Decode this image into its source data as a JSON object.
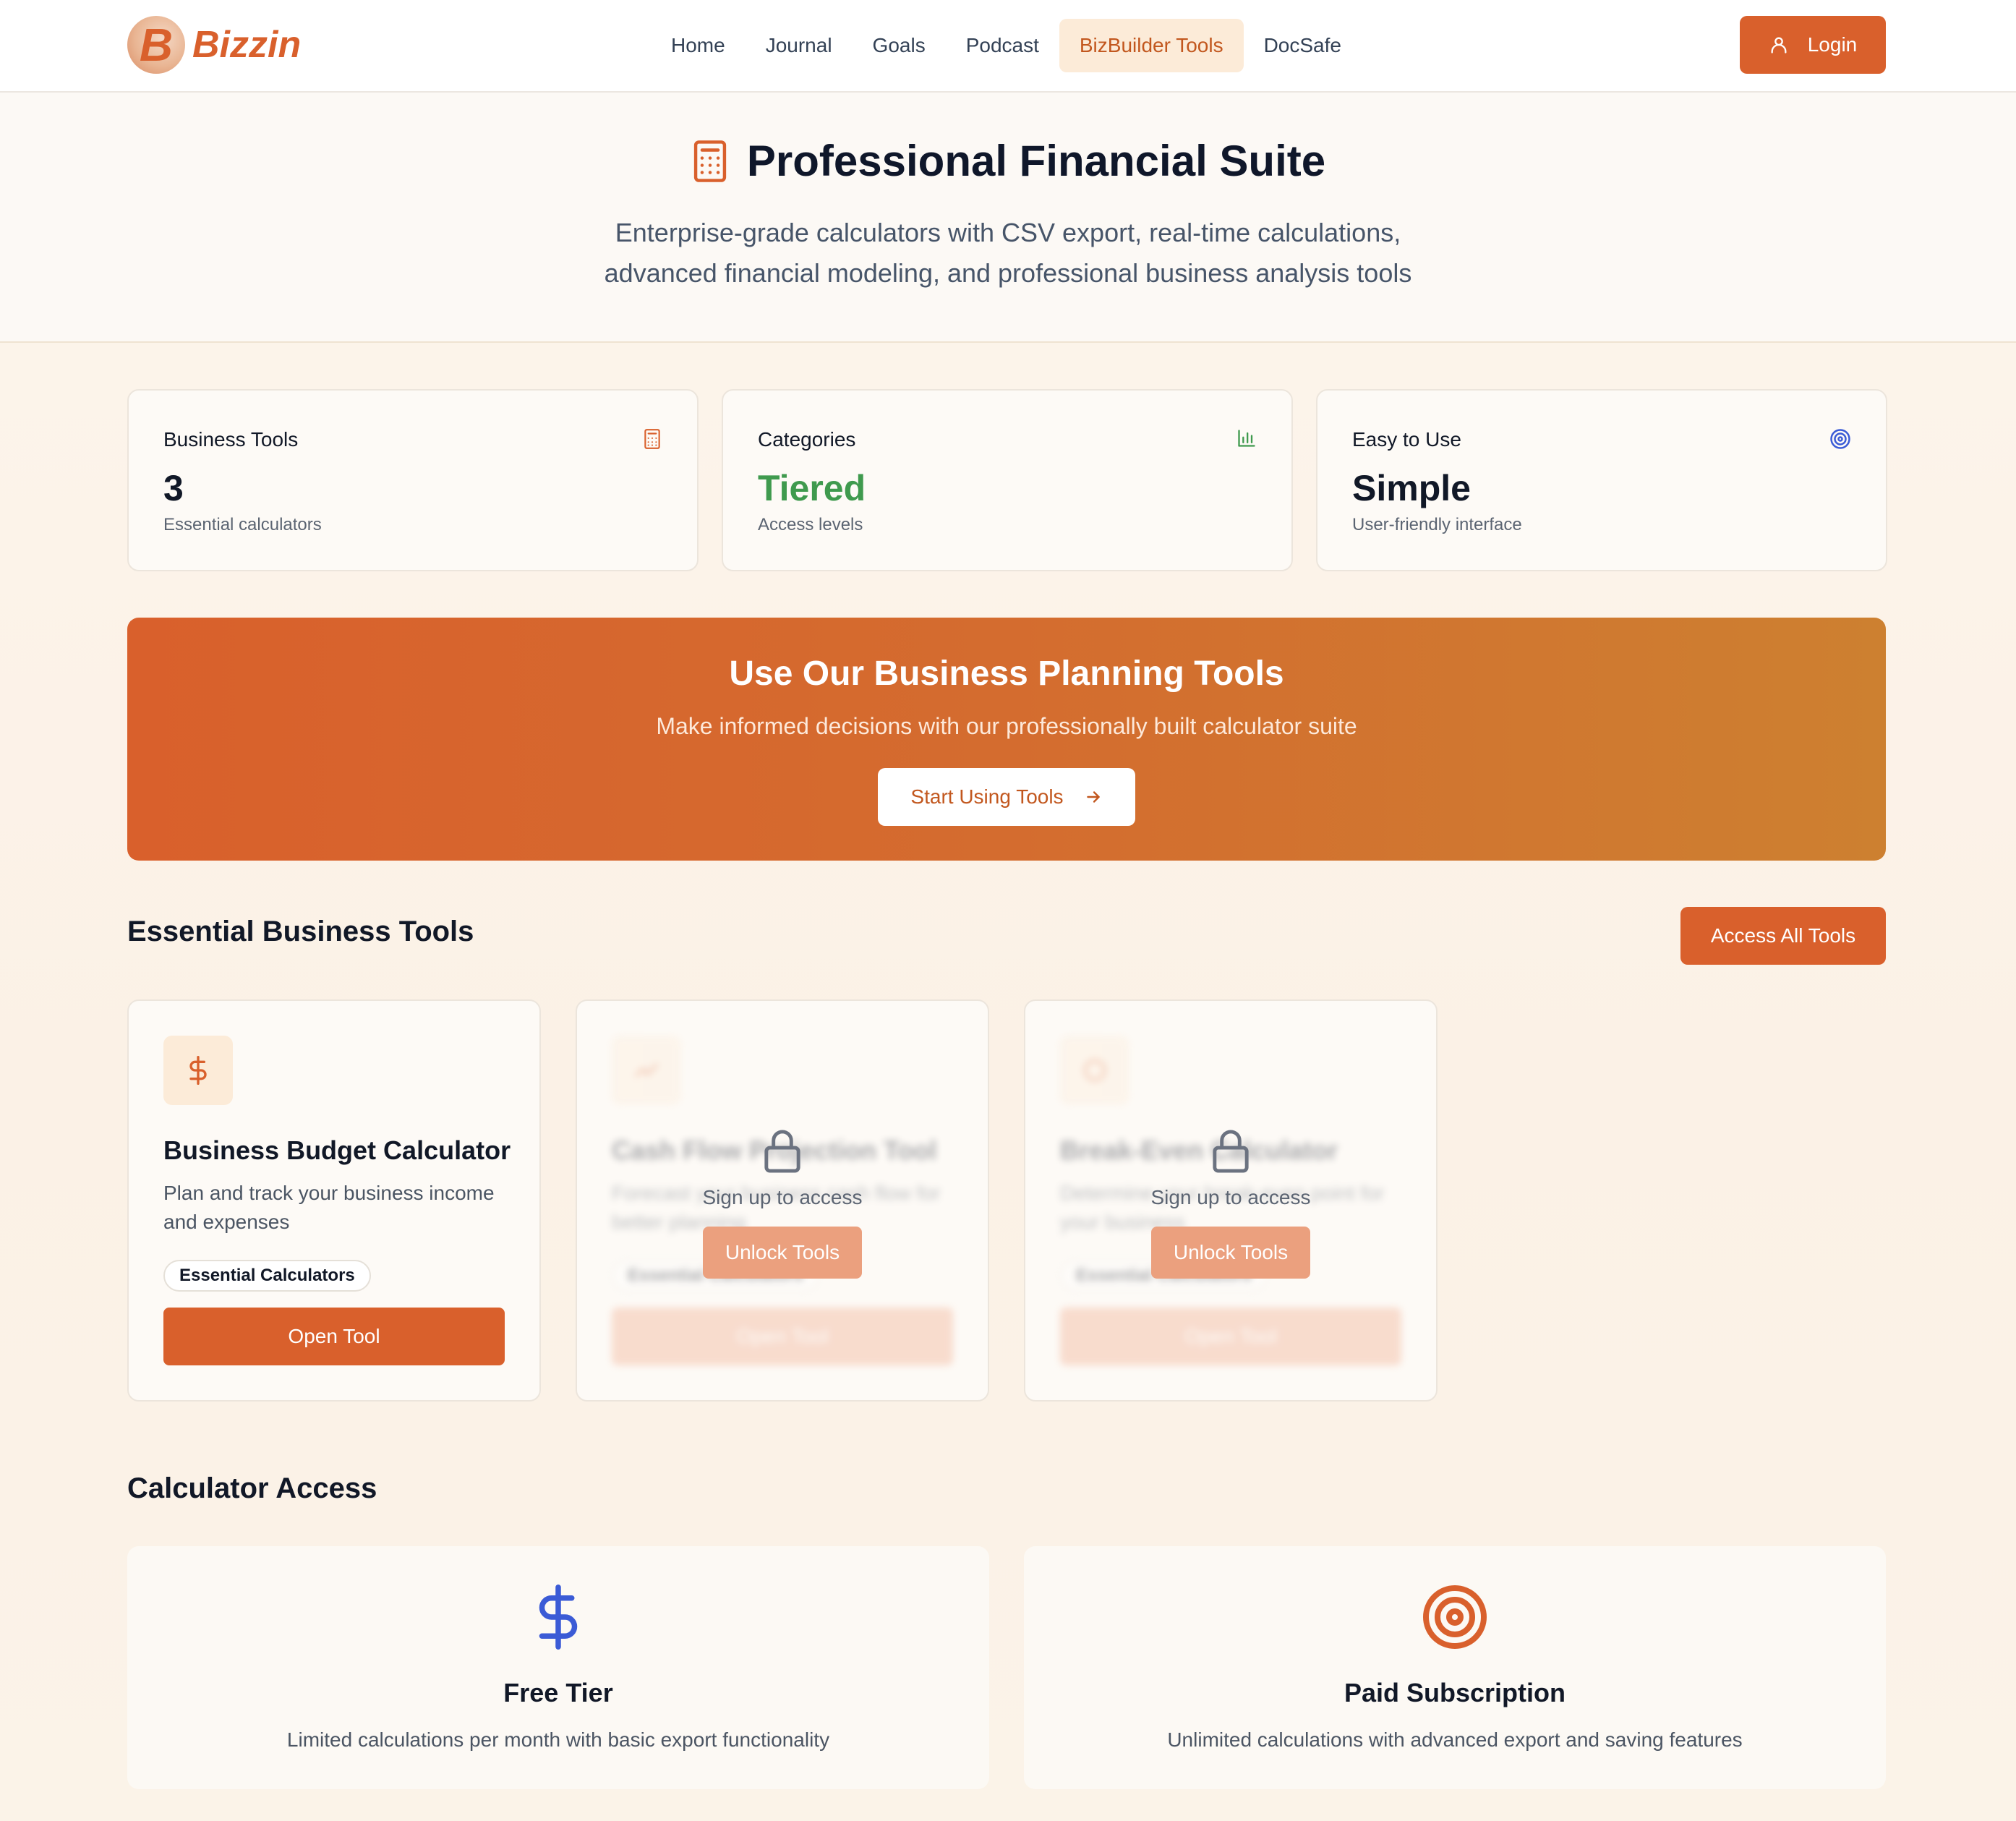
{
  "brand": {
    "logo_letter": "B",
    "name": "Bizzin"
  },
  "nav": {
    "links": [
      "Home",
      "Journal",
      "Goals",
      "Podcast",
      "BizBuilder Tools",
      "DocSafe"
    ],
    "active_index": 4,
    "login_label": "Login"
  },
  "hero": {
    "title": "Professional Financial Suite",
    "subtitle_line1": "Enterprise-grade calculators with CSV export, real-time calculations,",
    "subtitle_line2": "advanced financial modeling, and professional business analysis tools"
  },
  "stats": [
    {
      "label": "Business Tools",
      "value": "3",
      "desc": "Essential calculators",
      "icon": "calculator-icon"
    },
    {
      "label": "Categories",
      "value": "Tiered",
      "desc": "Access levels",
      "icon": "bar-chart-icon",
      "value_color": "#3f9a4e"
    },
    {
      "label": "Easy to Use",
      "value": "Simple",
      "desc": "User-friendly interface",
      "icon": "target-icon"
    }
  ],
  "banner": {
    "title": "Use Our Business Planning Tools",
    "subtitle": "Make informed decisions with our professionally built calculator suite",
    "button_label": "Start Using Tools"
  },
  "tools_section": {
    "title": "Essential Business Tools",
    "access_all_label": "Access All Tools",
    "tools": [
      {
        "name": "Business Budget Calculator",
        "desc": "Plan and track your business income and expenses",
        "tag": "Essential Calculators",
        "button": "Open Tool",
        "locked": false
      },
      {
        "name": "Cash Flow Projection Tool",
        "desc": "Forecast your business cash flow for better planning",
        "tag": "Essential Calculators",
        "button": "Open Tool",
        "locked": true,
        "lock_text": "Sign up to access",
        "unlock_label": "Unlock Tools"
      },
      {
        "name": "Break-Even Calculator",
        "desc": "Determine your break-even point for your business",
        "tag": "Essential Calculators",
        "button": "Open Tool",
        "locked": true,
        "lock_text": "Sign up to access",
        "unlock_label": "Unlock Tools"
      }
    ]
  },
  "access_section": {
    "title": "Calculator Access",
    "cards": [
      {
        "title": "Free Tier",
        "desc": "Limited calculations per month with basic export functionality",
        "icon": "dollar-icon"
      },
      {
        "title": "Paid Subscription",
        "desc": "Unlimited calculations with advanced export and saving features",
        "icon": "target-icon"
      }
    ]
  },
  "colors": {
    "accent": "#d9602c",
    "accent_soft": "#fcebd8",
    "success": "#3f9a4e",
    "info": "#3b5bd6"
  }
}
